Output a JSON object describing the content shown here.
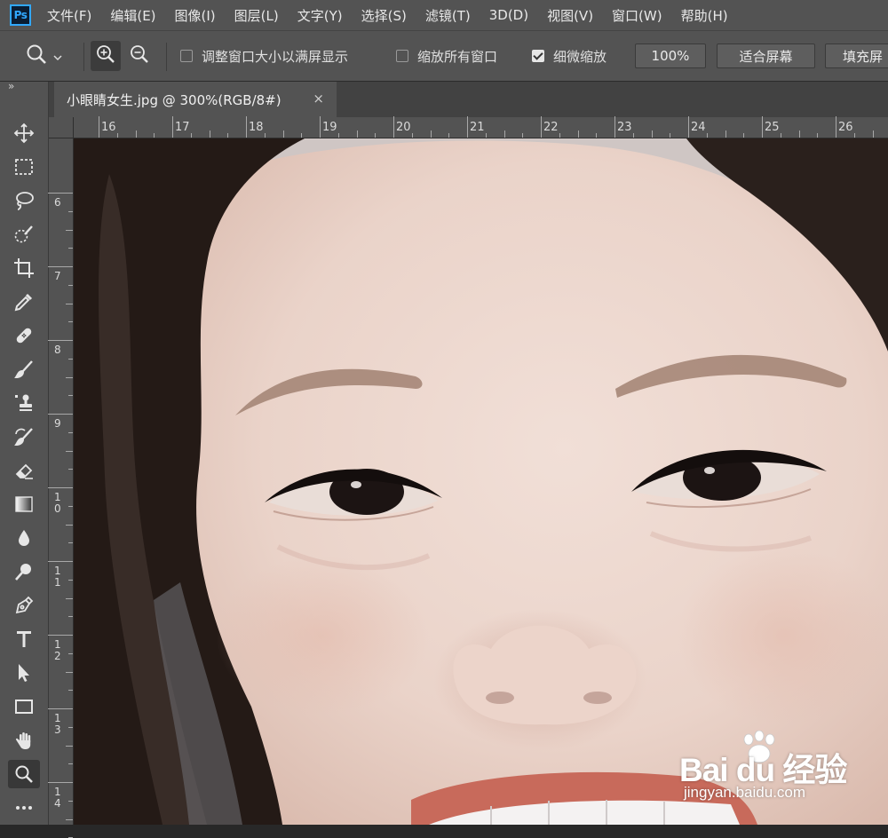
{
  "app": {
    "logo": "Ps"
  },
  "menu": [
    "文件(F)",
    "编辑(E)",
    "图像(I)",
    "图层(L)",
    "文字(Y)",
    "选择(S)",
    "滤镜(T)",
    "3D(D)",
    "视图(V)",
    "窗口(W)",
    "帮助(H)"
  ],
  "options": {
    "tool_icon": "zoom-tool-icon",
    "resize_windows": {
      "label": "调整窗口大小以满屏显示",
      "checked": false
    },
    "zoom_all_windows": {
      "label": "缩放所有窗口",
      "checked": false
    },
    "scrubby_zoom": {
      "label": "细微缩放",
      "checked": true
    },
    "zoom_percent": "100%",
    "fit_screen": "适合屏幕",
    "fill_screen": "填充屏"
  },
  "panel_collapse": "»",
  "document": {
    "tab_title": "小眼睛女生.jpg @ 300%(RGB/8#)",
    "close": "×"
  },
  "ruler_top": [
    "16",
    "17",
    "18",
    "19",
    "20",
    "21",
    "22",
    "23",
    "24",
    "25",
    "26"
  ],
  "ruler_left": [
    "6",
    "7",
    "8",
    "9",
    "10",
    "11",
    "12",
    "13",
    "14"
  ],
  "tools": [
    "move-tool-icon",
    "marquee-tool-icon",
    "lasso-tool-icon",
    "quick-selection-tool-icon",
    "crop-tool-icon",
    "eyedropper-tool-icon",
    "healing-brush-tool-icon",
    "brush-tool-icon",
    "clone-stamp-tool-icon",
    "history-brush-tool-icon",
    "eraser-tool-icon",
    "gradient-tool-icon",
    "blur-tool-icon",
    "dodge-tool-icon",
    "pen-tool-icon",
    "type-tool-icon",
    "path-selection-tool-icon",
    "rectangle-tool-icon",
    "hand-tool-icon",
    "zoom-tool-icon",
    "more-tools-icon"
  ],
  "colors": {
    "panel": "#535353",
    "dark": "#282828",
    "accent": "#31a8ff"
  },
  "watermark": {
    "brand": "Bai du 经验",
    "url": "jingyan.baidu.com"
  }
}
